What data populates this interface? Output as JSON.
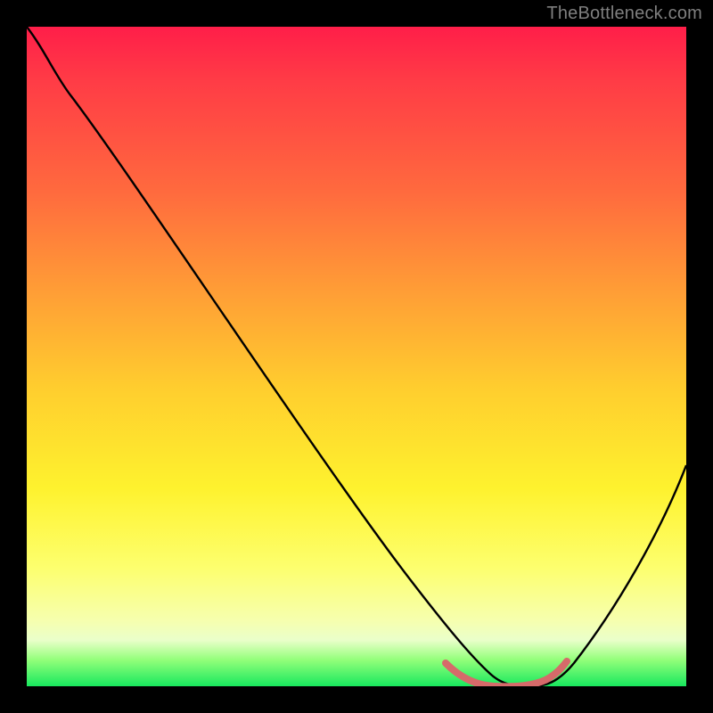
{
  "watermark": "TheBottleneck.com",
  "chart_data": {
    "type": "line",
    "title": "",
    "xlabel": "",
    "ylabel": "",
    "xlim": [
      0,
      100
    ],
    "ylim": [
      0,
      100
    ],
    "series": [
      {
        "name": "bottleneck-curve",
        "x": [
          0,
          5,
          10,
          20,
          30,
          40,
          50,
          58,
          62,
          66,
          70,
          74,
          78,
          82,
          88,
          94,
          100
        ],
        "values": [
          100,
          96,
          90,
          77,
          64,
          51,
          37,
          22,
          13,
          6,
          2,
          0,
          0,
          2,
          9,
          20,
          34
        ],
        "color": "#000000"
      },
      {
        "name": "highlight-flat-region",
        "x": [
          63,
          66,
          70,
          74,
          78,
          81
        ],
        "values": [
          4,
          1,
          0,
          0,
          1,
          4
        ],
        "color": "#d66a6a"
      }
    ],
    "gradient_stops": [
      {
        "pos": 0,
        "color": "#ff1e49"
      },
      {
        "pos": 25,
        "color": "#ff6a3e"
      },
      {
        "pos": 55,
        "color": "#ffce2e"
      },
      {
        "pos": 82,
        "color": "#fdff6e"
      },
      {
        "pos": 96,
        "color": "#93ff7a"
      },
      {
        "pos": 100,
        "color": "#18e85e"
      }
    ]
  }
}
